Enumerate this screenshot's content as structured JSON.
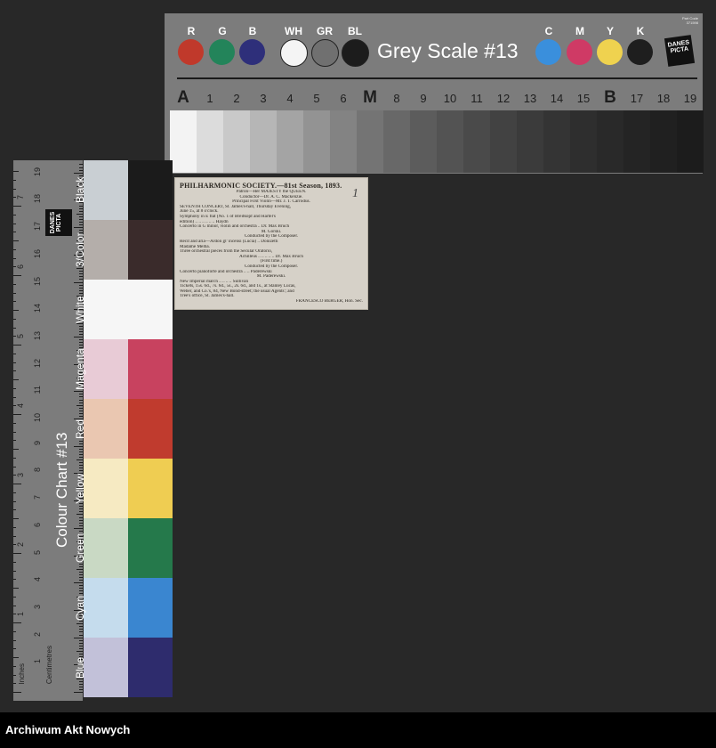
{
  "grey_scale": {
    "title": "Grey Scale #13",
    "code_label": "Part Code",
    "code": "371598",
    "logo": "DANES PICTA",
    "swatches": [
      {
        "label": "R",
        "color": "#c0392b"
      },
      {
        "label": "G",
        "color": "#23845a"
      },
      {
        "label": "B",
        "color": "#2e2f7a"
      },
      {
        "label": "WH",
        "color": "#f4f4f4"
      },
      {
        "label": "GR",
        "color": "#707070"
      },
      {
        "label": "BL",
        "color": "#1c1c1c"
      },
      {
        "label": "C",
        "color": "#3a8fdc"
      },
      {
        "label": "M",
        "color": "#cf3a65"
      },
      {
        "label": "Y",
        "color": "#efd24f"
      },
      {
        "label": "K",
        "color": "#1e1e1e"
      }
    ],
    "steps": [
      "A",
      "1",
      "2",
      "3",
      "4",
      "5",
      "6",
      "M",
      "8",
      "9",
      "10",
      "11",
      "12",
      "13",
      "14",
      "15",
      "B",
      "17",
      "18",
      "19"
    ],
    "step_colors": [
      "#f3f3f3",
      "#dcdcdc",
      "#c9c9c9",
      "#b6b6b6",
      "#a4a4a4",
      "#939393",
      "#838383",
      "#747474",
      "#686868",
      "#5c5c5c",
      "#535353",
      "#4a4a4a",
      "#424242",
      "#3b3b3b",
      "#343434",
      "#2e2e2e",
      "#292929",
      "#242424",
      "#202020",
      "#1c1c1c"
    ]
  },
  "colour_chart": {
    "title": "Colour Chart #13",
    "logo": "DANES PICTA",
    "units_inches": "Inches",
    "units_cm": "Centimetres",
    "patches": [
      {
        "label": "Black",
        "light": "#c9cfd3",
        "dark": "#1b1b1b"
      },
      {
        "label": "3/Color",
        "light": "#b4aeaa",
        "dark": "#3a2b2b"
      },
      {
        "label": "White",
        "light": "#f6f6f6",
        "dark": "#f6f6f6"
      },
      {
        "label": "Magenta",
        "light": "#e8cbd6",
        "dark": "#c8425f"
      },
      {
        "label": "Red",
        "light": "#eac7b1",
        "dark": "#c03b2e"
      },
      {
        "label": "Yellow",
        "light": "#f6eac2",
        "dark": "#efcd52"
      },
      {
        "label": "Green",
        "light": "#c9d9c4",
        "dark": "#25794b"
      },
      {
        "label": "Cyan",
        "light": "#c5dced",
        "dark": "#3a86d0"
      },
      {
        "label": "Blue",
        "light": "#c2c1d9",
        "dark": "#2e2c6d"
      }
    ],
    "cm_numbers": [
      "1",
      "2",
      "3",
      "4",
      "5",
      "6",
      "7",
      "8",
      "9",
      "10",
      "11",
      "12",
      "13",
      "14",
      "15",
      "16",
      "17",
      "18",
      "19"
    ],
    "inch_numbers": [
      "1",
      "2",
      "3",
      "4",
      "5",
      "6",
      "7"
    ]
  },
  "clipping": {
    "heading": "PHILHARMONIC SOCIETY.—81st Season, 1893.",
    "mark": "1",
    "lines": [
      "Patron—Her MAJESTY the QUEEN.",
      "Conductor—Dr. A. C. Mackenzie.",
      "Principal First Violin—Mr. J. T. Carrodus.",
      "SEVENTH CONCERT, St. James's-hall, Thursday Evening,",
      "June 15, at 8 o'clock.",
      "Symphony in E flat (No. 1 of Breitkopf and Härtel's",
      "edition) .. .. .. .. .. .. Haydn",
      "Concerto in G minor, violin and orchestra .. Dr. Max Bruch",
      "M. Gorski.",
      "Conducted by the Composer.",
      "Recit and aria—Ardon gl' incensi (Lucia) .. Donizetti",
      "Madame Melba.",
      "Three orchestral pieces from the Secular Oratorio,",
      "Achilleus .. .. .. .. .. Dr. Max Bruch",
      "(First time.)",
      "Conducted by the Composer.",
      "Concerto pianoforte and orchestra .. .. Paderewski",
      "M. Paderewski.",
      "New Imperial march .. .. .. .. Sullivan",
      "Tickets, 15s. 6d., 7s. 6d., 5s., 2s. 6d., and 1s., at Stanley Lucas,",
      "Weber, and Co.'s, 84, New Bond-street; the usual Agents'; and",
      "Tree's office, St. James's-hall.",
      "FRANCESCO BERGER, Hon. Sec."
    ]
  },
  "footer": {
    "text": "Archiwum Akt Nowych"
  }
}
